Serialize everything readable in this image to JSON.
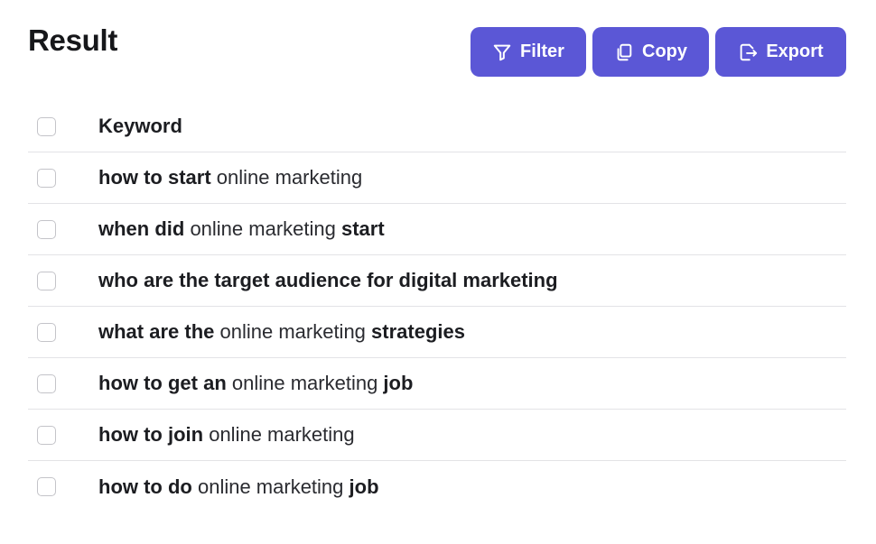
{
  "title": "Result",
  "toolbar": {
    "filter_label": "Filter",
    "copy_label": "Copy",
    "export_label": "Export",
    "accent": "#5b57d6"
  },
  "table": {
    "header": "Keyword",
    "rows": [
      [
        {
          "t": "how to start",
          "b": true
        },
        {
          "t": " online marketing",
          "b": false
        }
      ],
      [
        {
          "t": "when did",
          "b": true
        },
        {
          "t": " online marketing ",
          "b": false
        },
        {
          "t": "start",
          "b": true
        }
      ],
      [
        {
          "t": "who are the target audience for digital marketing",
          "b": true
        }
      ],
      [
        {
          "t": "what are the",
          "b": true
        },
        {
          "t": " online marketing ",
          "b": false
        },
        {
          "t": "strategies",
          "b": true
        }
      ],
      [
        {
          "t": "how to get an",
          "b": true
        },
        {
          "t": " online marketing ",
          "b": false
        },
        {
          "t": "job",
          "b": true
        }
      ],
      [
        {
          "t": "how to join",
          "b": true
        },
        {
          "t": " online marketing",
          "b": false
        }
      ],
      [
        {
          "t": "how to do",
          "b": true
        },
        {
          "t": " online marketing ",
          "b": false
        },
        {
          "t": "job",
          "b": true
        }
      ]
    ]
  }
}
